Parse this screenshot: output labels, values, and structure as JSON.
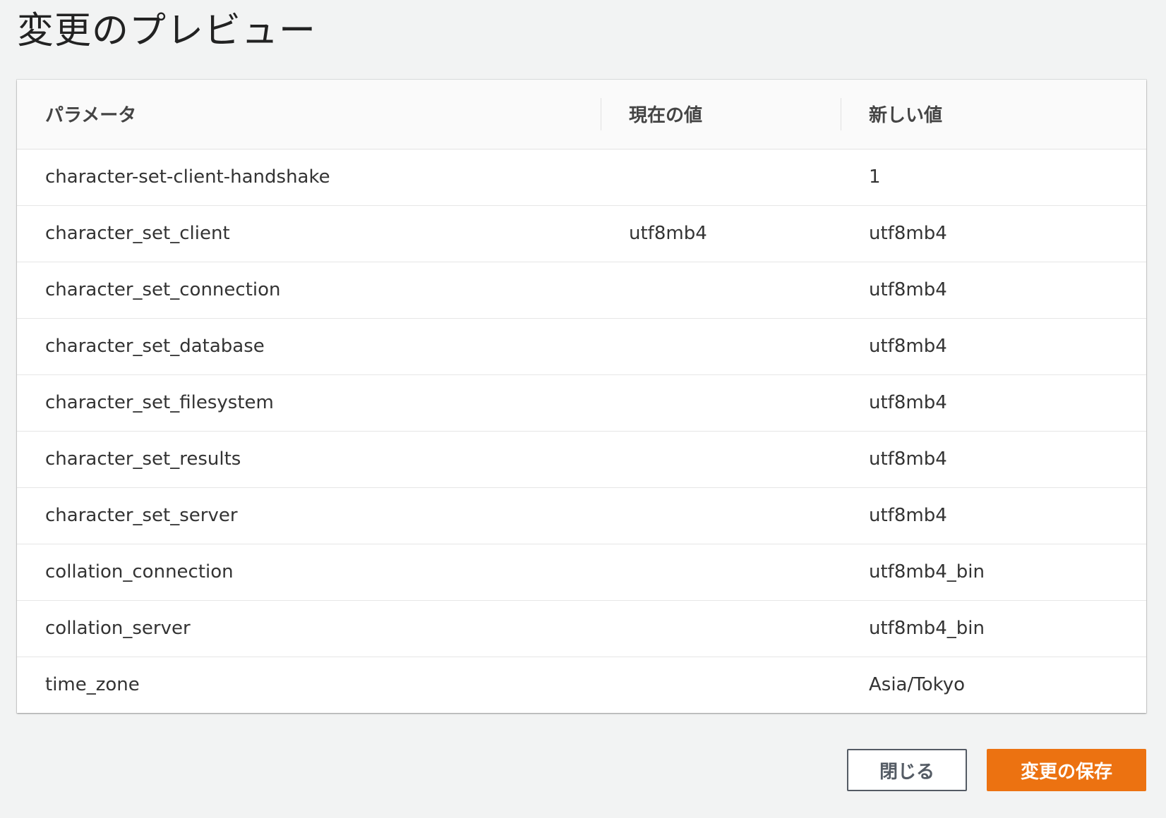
{
  "page": {
    "title": "変更のプレビュー"
  },
  "table": {
    "columns": {
      "parameter": "パラメータ",
      "current": "現在の値",
      "new": "新しい値"
    },
    "rows": [
      {
        "parameter": "character-set-client-handshake",
        "current": "",
        "new": "1"
      },
      {
        "parameter": "character_set_client",
        "current": "utf8mb4",
        "new": "utf8mb4"
      },
      {
        "parameter": "character_set_connection",
        "current": "",
        "new": "utf8mb4"
      },
      {
        "parameter": "character_set_database",
        "current": "",
        "new": "utf8mb4"
      },
      {
        "parameter": "character_set_filesystem",
        "current": "",
        "new": "utf8mb4"
      },
      {
        "parameter": "character_set_results",
        "current": "",
        "new": "utf8mb4"
      },
      {
        "parameter": "character_set_server",
        "current": "",
        "new": "utf8mb4"
      },
      {
        "parameter": "collation_connection",
        "current": "",
        "new": "utf8mb4_bin"
      },
      {
        "parameter": "collation_server",
        "current": "",
        "new": "utf8mb4_bin"
      },
      {
        "parameter": "time_zone",
        "current": "",
        "new": "Asia/Tokyo"
      }
    ]
  },
  "footer": {
    "close_label": "閉じる",
    "save_label": "変更の保存"
  },
  "colors": {
    "accent": "#ec7211",
    "background": "#f2f3f3"
  }
}
